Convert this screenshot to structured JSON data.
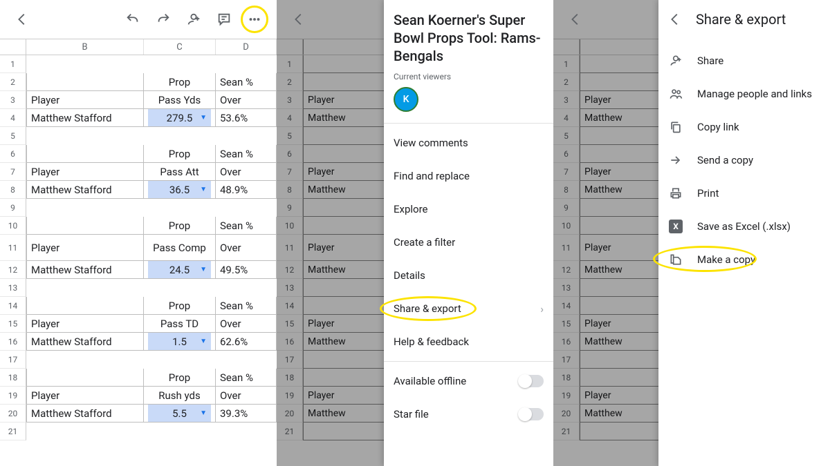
{
  "columns": [
    "B",
    "C",
    "D"
  ],
  "blocks": [
    {
      "prop_label": "Prop",
      "sean_label": "Sean %",
      "player_hdr": "Player",
      "stat": "Pass Yds",
      "ou": "Over",
      "player": "Matthew Stafford",
      "line": "279.5",
      "pct": "53.6%"
    },
    {
      "prop_label": "Prop",
      "sean_label": "Sean %",
      "player_hdr": "Player",
      "stat": "Pass Att",
      "ou": "Over",
      "player": "Matthew Stafford",
      "line": "36.5",
      "pct": "48.9%"
    },
    {
      "prop_label": "Prop",
      "sean_label": "Sean %",
      "player_hdr": "Player",
      "stat": "Pass Comp",
      "ou": "Over",
      "player": "Matthew Stafford",
      "line": "24.5",
      "pct": "49.5%"
    },
    {
      "prop_label": "Prop",
      "sean_label": "Sean %",
      "player_hdr": "Player",
      "stat": "Pass TD",
      "ou": "Over",
      "player": "Matthew Stafford",
      "line": "1.5",
      "pct": "62.6%"
    },
    {
      "prop_label": "Prop",
      "sean_label": "Sean %",
      "player_hdr": "Player",
      "stat": "Rush yds",
      "ou": "Over",
      "player": "Matthew Stafford",
      "line": "5.5",
      "pct": "39.3%"
    }
  ],
  "bg_rows": {
    "player_hdr": "Player",
    "player": "Matthew"
  },
  "doc_title": "Sean Koerner's Super Bowl Props Tool: Rams-Bengals",
  "current_viewers_label": "Current viewers",
  "avatar_initial": "K",
  "menu2": {
    "view_comments": "View comments",
    "find_replace": "Find and replace",
    "explore": "Explore",
    "create_filter": "Create a filter",
    "details": "Details",
    "share_export": "Share & export",
    "help": "Help & feedback",
    "offline": "Available offline",
    "star": "Star file"
  },
  "menu3": {
    "title": "Share & export",
    "share": "Share",
    "manage": "Manage people and links",
    "copylink": "Copy link",
    "send": "Send a copy",
    "print": "Print",
    "excel": "Save as Excel (.xlsx)",
    "makecopy": "Make a copy"
  }
}
